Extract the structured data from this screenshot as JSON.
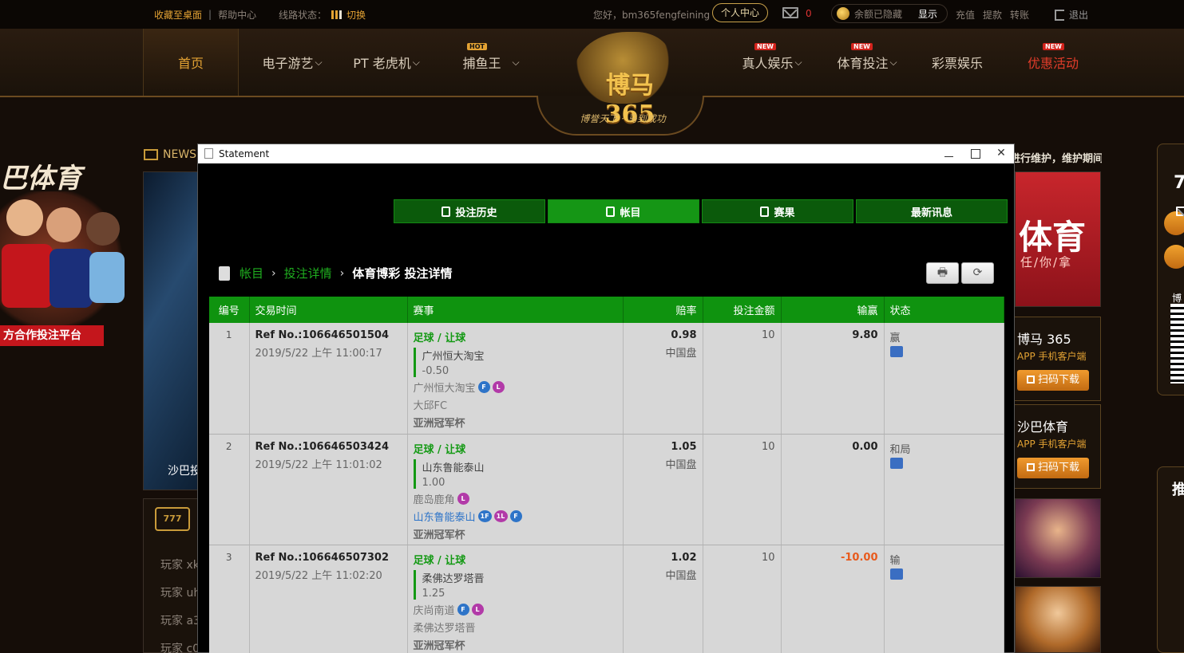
{
  "topbar": {
    "favorite": "收藏至桌面",
    "divider": "|",
    "help": "帮助中心",
    "line_status": "线路状态：",
    "switch": "切换",
    "greeting": "您好，bm365fengfeining",
    "user_center": "个人中心",
    "mail_count": "0",
    "balance_hidden": "余额已隐藏",
    "show": "显示",
    "deposit": "充值",
    "withdraw": "提款",
    "transfer": "转账",
    "logout": "退出"
  },
  "nav": {
    "home": "首页",
    "electronic": "电子游艺",
    "pt": "PT 老虎机",
    "fishing": "捕鱼王",
    "live": "真人娱乐",
    "sports": "体育投注",
    "lottery": "彩票娱乐",
    "promo": "优惠活动",
    "badge_hot": "HOT",
    "badge_new": "NEW"
  },
  "logo": {
    "title": "博马365",
    "slogan": "博誉天下 · 马到成功"
  },
  "background": {
    "left_title": "巴体育",
    "left_red": "方合作投注平台",
    "news": "NEWS",
    "banner_caption": "沙巴投",
    "players": [
      "玩家 xk",
      "玩家 uh",
      "玩家 a3",
      "玩家 c0"
    ],
    "right_notice": "进行维护，维护期间",
    "right_promo_title": "体育",
    "right_promo_sub": "任/你/拿",
    "app1_name": "博马 365",
    "app1_sub": "APP 手机客户端",
    "app2_name": "沙巴体育",
    "app2_sub": "APP 手机客户端",
    "download": "扫码下载",
    "far_right_num": "7",
    "far_right_label": "博",
    "far_right_title": "推"
  },
  "window": {
    "title": "Statement",
    "min": "—",
    "max": "□",
    "close": "✕",
    "tabs": [
      {
        "label": "投注历史",
        "active": false
      },
      {
        "label": "帐目",
        "active": true
      },
      {
        "label": "赛果",
        "active": false
      },
      {
        "label": "最新讯息",
        "active": false
      }
    ],
    "breadcrumb": {
      "root": "帐目",
      "level2": "投注详情",
      "current": "体育博彩 投注详情",
      "sep": "›"
    },
    "print_icon": "🖶",
    "refresh_icon": "⟳"
  },
  "table": {
    "headers": {
      "no": "编号",
      "time": "交易时间",
      "event": "赛事",
      "odds": "赔率",
      "stake": "投注金额",
      "pl": "输赢",
      "status": "状态"
    },
    "rows": [
      {
        "no": "1",
        "ref": "Ref No.:106646501504",
        "datetime": "2019/5/22 上午 11:00:17",
        "sport": "足球 / 让球",
        "pick": "广州恒大淘宝",
        "line": "-0.50",
        "team1": "广州恒大淘宝",
        "team1_badges": [
          "F",
          "L"
        ],
        "team2": "大邱FC",
        "team2_badges": [],
        "league": "亚洲冠军杯",
        "odds": "0.98",
        "odds_type": "中国盘",
        "stake": "10",
        "pl": "9.80",
        "status": "赢"
      },
      {
        "no": "2",
        "ref": "Ref No.:106646503424",
        "datetime": "2019/5/22 上午 11:01:02",
        "sport": "足球 / 让球",
        "pick": "山东鲁能泰山",
        "line": "1.00",
        "team1": "鹿岛鹿角",
        "team1_badges": [
          "L"
        ],
        "team2": "山东鲁能泰山",
        "team2_badges": [
          "1F",
          "1L",
          "F"
        ],
        "league": "亚洲冠军杯",
        "odds": "1.05",
        "odds_type": "中国盘",
        "stake": "10",
        "pl": "0.00",
        "status": "和局"
      },
      {
        "no": "3",
        "ref": "Ref No.:106646507302",
        "datetime": "2019/5/22 上午 11:02:20",
        "sport": "足球 / 让球",
        "pick": "柔佛达罗塔晋",
        "line": "1.25",
        "team1": "庆尚南道",
        "team1_badges": [
          "F",
          "L"
        ],
        "team2": "柔佛达罗塔晋",
        "team2_badges": [],
        "league": "亚洲冠军杯",
        "odds": "1.02",
        "odds_type": "中国盘",
        "stake": "10",
        "pl": "-10.00",
        "status": "输"
      }
    ]
  },
  "colors": {
    "accent_gold": "#e3a233",
    "tab_green": "#0b5a0b",
    "tab_active": "#159615",
    "header_green": "#0f930f",
    "loss_orange": "#e85a1c"
  }
}
